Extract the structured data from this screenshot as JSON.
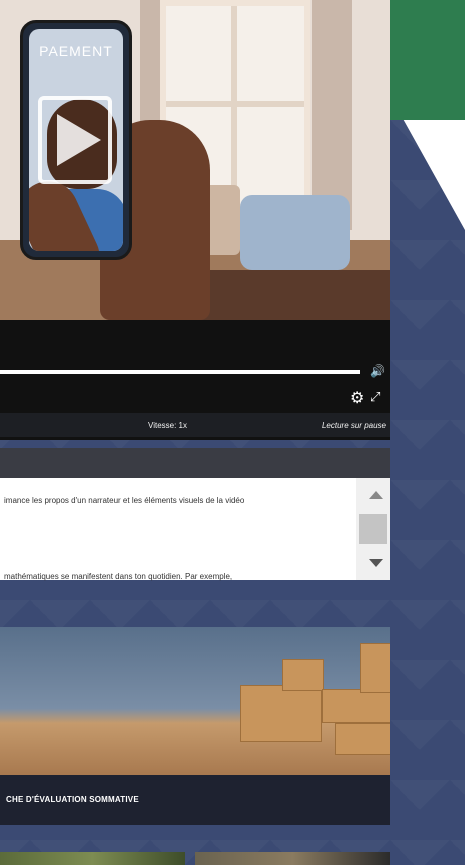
{
  "phone": {
    "title": "PAEMENT"
  },
  "player": {
    "progress": 1.0,
    "speed_label": "Vitesse: 1x",
    "autoplay_label": "Lecture sur pause",
    "icons": {
      "play": "play-icon",
      "volume": "volume-icon",
      "settings": "gear-icon",
      "fullscreen": "expand-icon"
    }
  },
  "transcript": {
    "lines": [
      "imance les propos d'un narrateur et les éléments visuels de la vidéo",
      "mathématiques se manifestent dans ton quotidien. Par exemple,"
    ]
  },
  "card": {
    "title": "CHE D'ÉVALUATION SOMMATIVE"
  },
  "colors": {
    "accent_green": "#2e7d4f",
    "background_blue": "#3b4a73",
    "dark_panel": "#1e2230"
  }
}
